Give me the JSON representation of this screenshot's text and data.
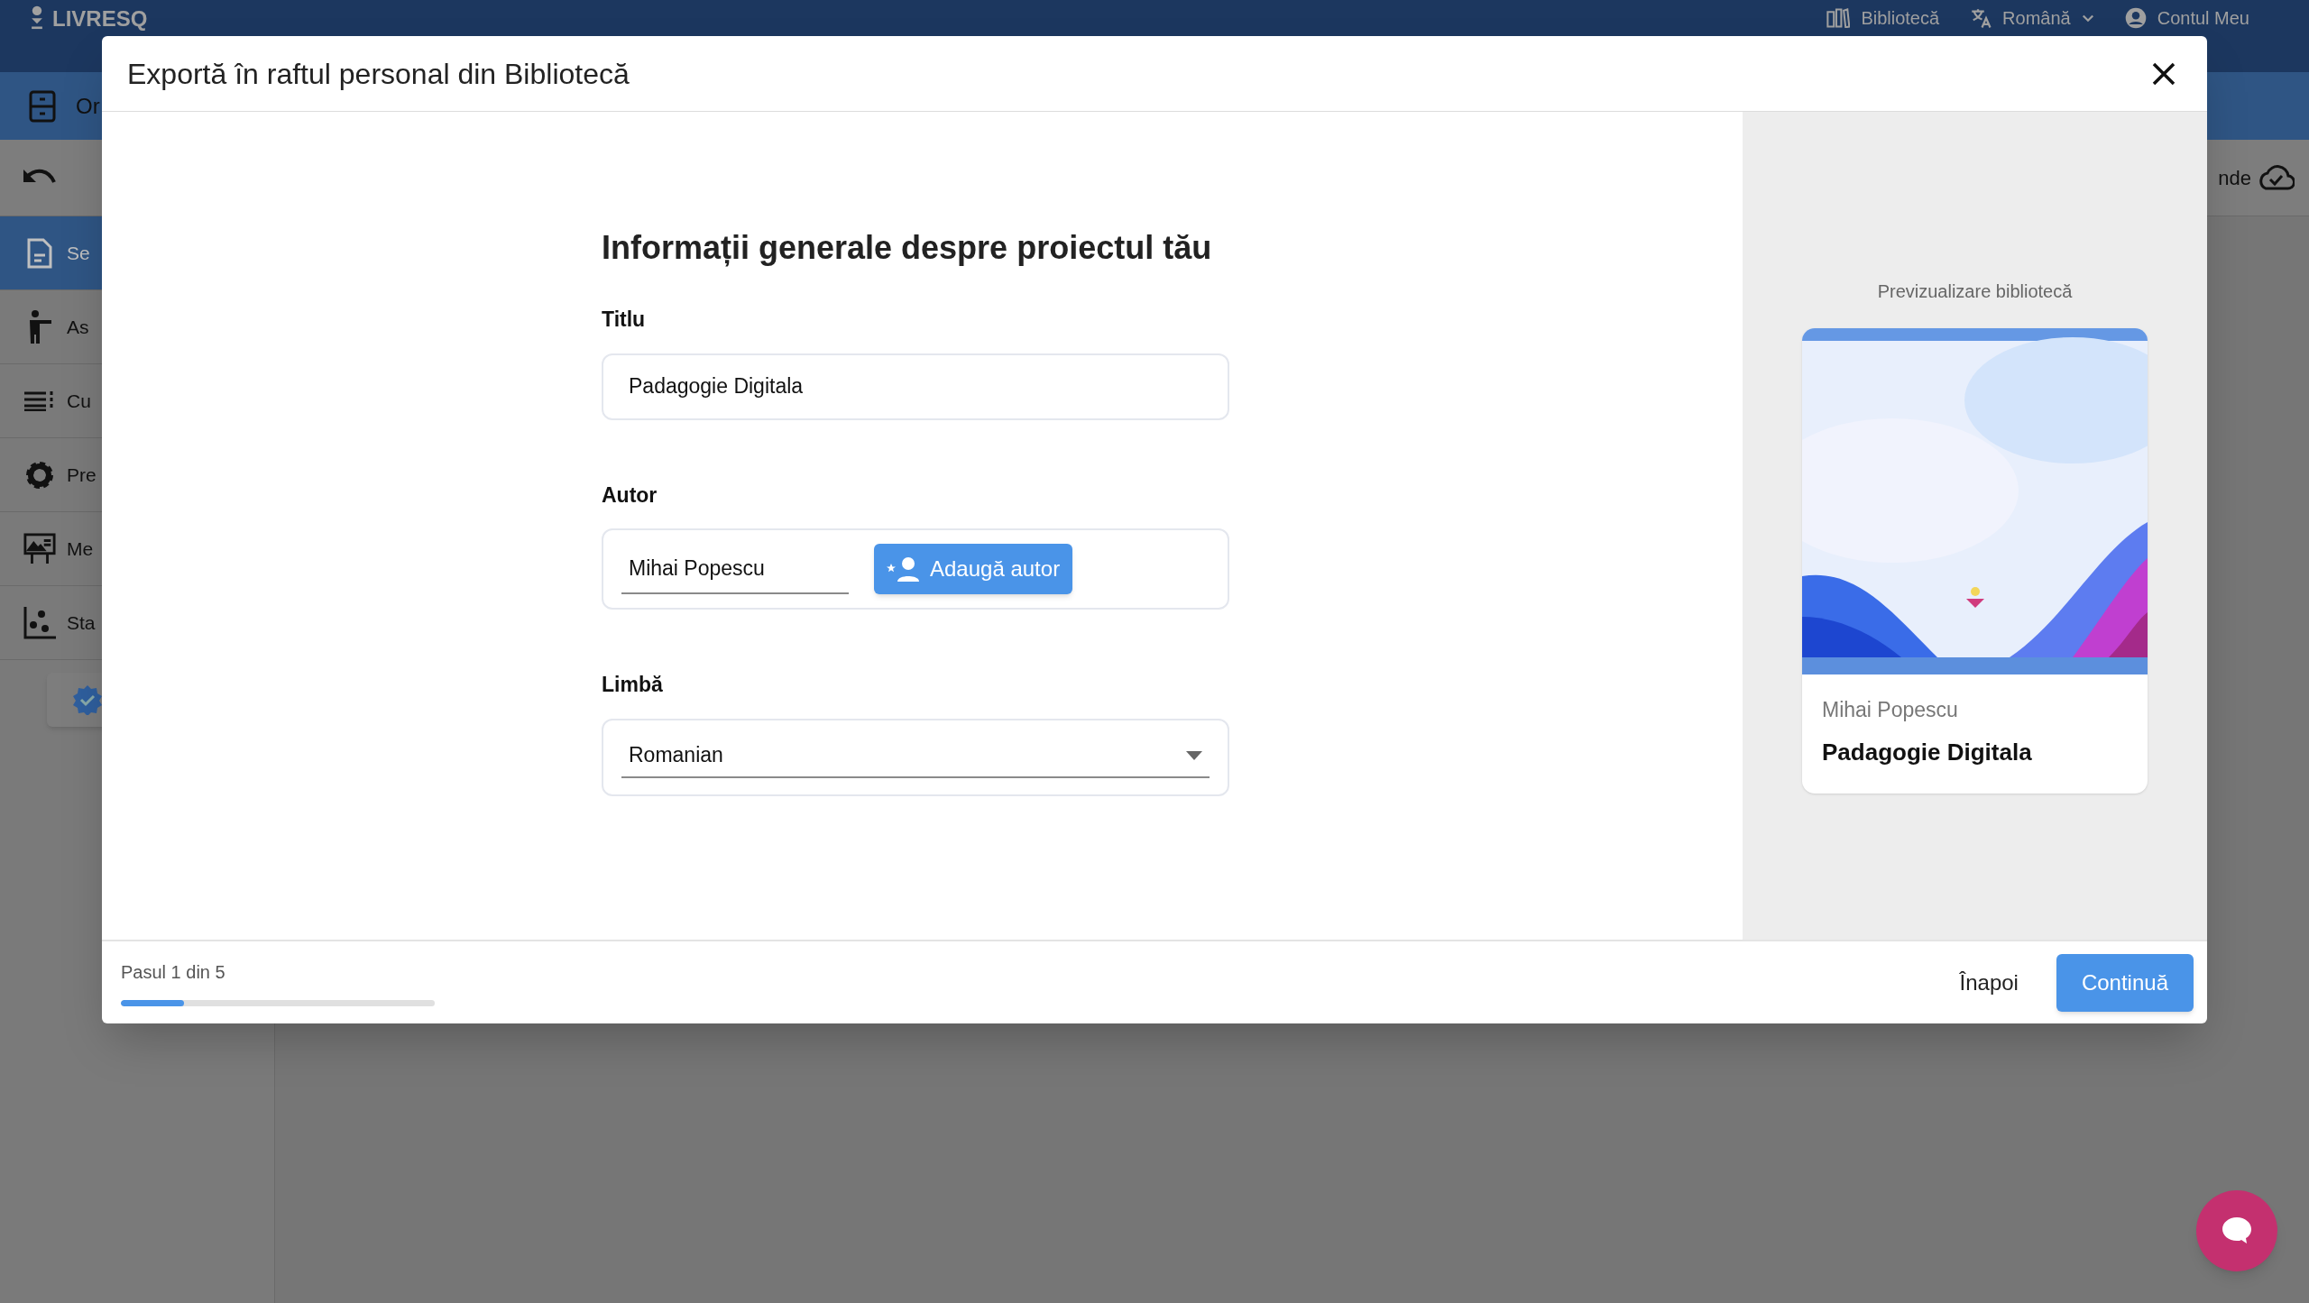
{
  "app_header": {
    "logo": "LIVRESQ",
    "nav": [
      {
        "label": "Bibliotecă"
      },
      {
        "label": "Română"
      },
      {
        "label": "Contul Meu"
      }
    ]
  },
  "org_bar": {
    "label": "Or"
  },
  "toolbar": {
    "save_status": "nde"
  },
  "sidebar": {
    "items": [
      {
        "label": "Se",
        "selected": true
      },
      {
        "label": "As",
        "selected": false
      },
      {
        "label": "Cu",
        "selected": false
      },
      {
        "label": "Pre",
        "selected": false
      },
      {
        "label": "Me",
        "selected": false
      },
      {
        "label": "Sta",
        "selected": false
      }
    ]
  },
  "dialog": {
    "title": "Exportă în raftul personal din Bibliotecă",
    "heading": "Informații generale despre proiectul tău",
    "fields": [
      {
        "kind": "text",
        "label": "Titlu",
        "value": "Padagogie Digitala"
      },
      {
        "kind": "author",
        "label": "Autor",
        "value": "Mihai Popescu",
        "button": "Adaugă autor"
      },
      {
        "kind": "select",
        "label": "Limbă",
        "value": "Romanian"
      }
    ],
    "preview": {
      "caption": "Previzualizare bibliotecă",
      "author": "Mihai Popescu",
      "title": "Padagogie Digitala"
    },
    "footer": {
      "step": "Pasul 1 din 5",
      "level": 0.2,
      "back": "Înapoi",
      "next": "Continuă"
    }
  }
}
